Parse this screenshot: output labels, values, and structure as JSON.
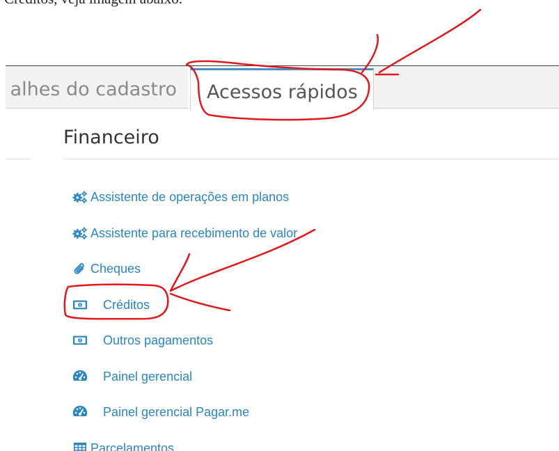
{
  "caption": "Créditos, veja imagem abaixo.",
  "tabs": [
    {
      "label": "alhes do cadastro",
      "active": false
    },
    {
      "label": "Acessos rápidos",
      "active": true
    }
  ],
  "section": {
    "title": "Financeiro",
    "links": [
      {
        "label": "Assistente de operações em planos",
        "icon": "cogs-icon"
      },
      {
        "label": "Assistente para recebimento de valor",
        "icon": "cogs-icon"
      },
      {
        "label": "Cheques",
        "icon": "paperclip-icon"
      },
      {
        "label": "Créditos",
        "icon": "money-icon"
      },
      {
        "label": "Outros pagamentos",
        "icon": "money-icon"
      },
      {
        "label": "Painel gerencial",
        "icon": "dashboard-icon"
      },
      {
        "label": "Painel gerencial Pagar.me",
        "icon": "dashboard-icon"
      },
      {
        "label": "Parcelamentos",
        "icon": "table-icon"
      }
    ]
  },
  "colors": {
    "link": "#2a86c4",
    "tab_accent": "#4a90c8",
    "annotation": "#e3161b"
  }
}
